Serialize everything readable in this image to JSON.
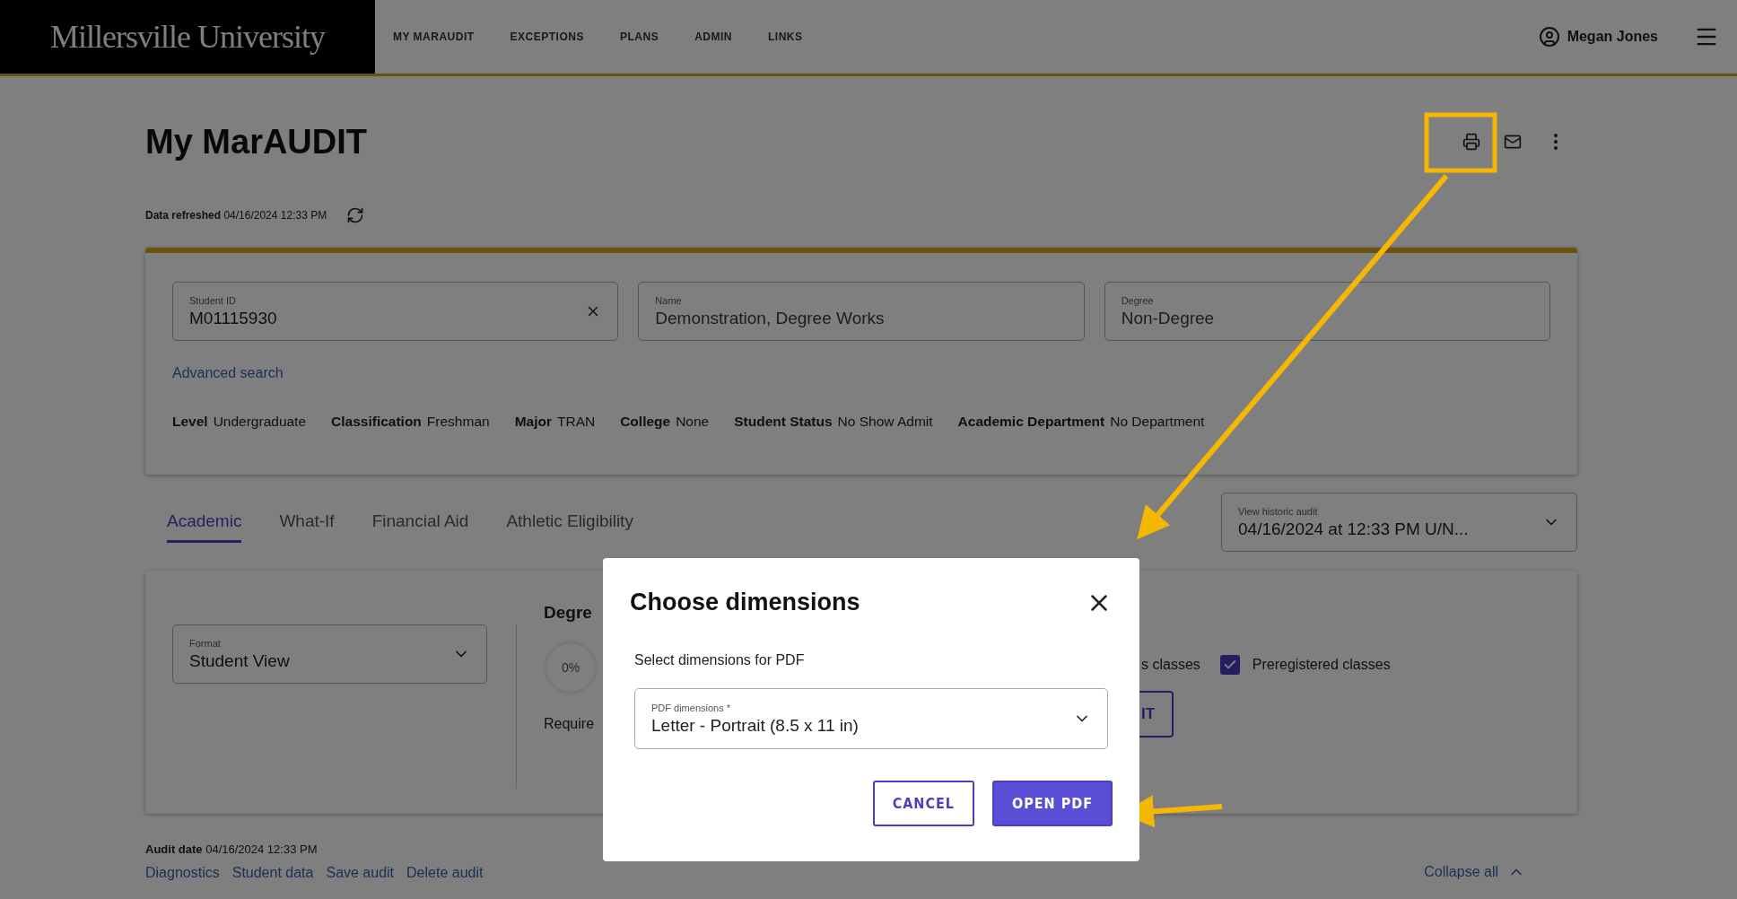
{
  "header": {
    "logo": "Millersville University",
    "nav": [
      "MY MARAUDIT",
      "EXCEPTIONS",
      "PLANS",
      "ADMIN",
      "LINKS"
    ],
    "user": "Megan Jones"
  },
  "page": {
    "title": "My MarAUDIT",
    "refresh_label": "Data refreshed",
    "refresh_value": "04/16/2024 12:33 PM"
  },
  "student_card": {
    "fields": [
      {
        "label": "Student ID",
        "value": "M01115930",
        "clearable": true
      },
      {
        "label": "Name",
        "value": "Demonstration, Degree Works",
        "clearable": false
      },
      {
        "label": "Degree",
        "value": "Non-Degree",
        "clearable": false
      }
    ],
    "advanced_search": "Advanced search",
    "attributes": [
      {
        "label": "Level",
        "value": "Undergraduate"
      },
      {
        "label": "Classification",
        "value": "Freshman"
      },
      {
        "label": "Major",
        "value": "TRAN"
      },
      {
        "label": "College",
        "value": "None"
      },
      {
        "label": "Student Status",
        "value": "No Show Admit"
      },
      {
        "label": "Academic Department",
        "value": "No Department"
      }
    ]
  },
  "audit_tabs": [
    {
      "label": "Academic",
      "selected": true
    },
    {
      "label": "What-If",
      "selected": false
    },
    {
      "label": "Financial Aid",
      "selected": false
    },
    {
      "label": "Athletic Eligibility",
      "selected": false
    }
  ],
  "historic_audit": {
    "label": "View historic audit",
    "value": "04/16/2024 at 12:33 PM U/N..."
  },
  "audit_card": {
    "format": {
      "label": "Format",
      "value": "Student View"
    },
    "heading": "Degre",
    "progress": "0%",
    "requirements": "Require",
    "classes_text": "s classes",
    "options": [
      {
        "label": "Preregistered classes",
        "checked": true
      }
    ],
    "button": "IT"
  },
  "audit_info": {
    "label": "Audit date",
    "value": "04/16/2024 12:33 PM",
    "links": [
      "Diagnostics",
      "Student data",
      "Save audit",
      "Delete audit"
    ],
    "collapse": "Collapse all"
  },
  "dialog": {
    "title": "Choose dimensions",
    "text": "Select dimensions for PDF",
    "select": {
      "label": "PDF dimensions *",
      "value": "Letter - Portrait (8.5 x 11 in)"
    },
    "buttons": [
      {
        "label": "CANCEL",
        "kind": "outlined"
      },
      {
        "label": "OPEN PDF",
        "kind": "filled"
      }
    ]
  }
}
